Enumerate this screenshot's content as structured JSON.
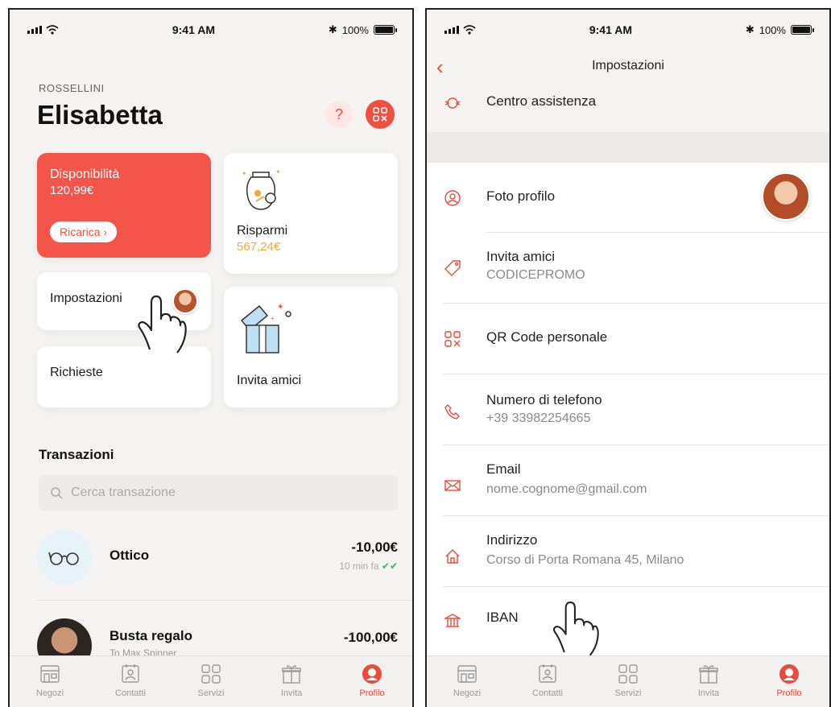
{
  "status_bar": {
    "time": "9:41 AM",
    "battery": "100%"
  },
  "left": {
    "surname": "ROSSELLINI",
    "firstname": "Elisabetta",
    "help_label": "?",
    "cards": {
      "disponibilita": {
        "title": "Disponibilità",
        "amount": "120,99€",
        "button": "Ricarica ›"
      },
      "risparmi": {
        "title": "Risparmi",
        "amount": "567,24€"
      },
      "impostazioni": {
        "title": "Impostazioni"
      },
      "invita": {
        "title": "Invita amici"
      },
      "richieste": {
        "title": "Richieste"
      }
    },
    "transactions_title": "Transazioni",
    "search_placeholder": "Cerca transazione",
    "transactions": [
      {
        "name": "Ottico",
        "sub": "",
        "amount": "-10,00€",
        "time": "10 min fa",
        "status": "✔✔"
      },
      {
        "name": "Busta regalo",
        "sub": "To Max Spinner",
        "amount": "-100,00€",
        "time": ""
      }
    ]
  },
  "right": {
    "title": "Impostazioni",
    "back_label": "‹",
    "items": {
      "centro": {
        "label": "Centro assistenza"
      },
      "foto": {
        "label": "Foto profilo"
      },
      "invita": {
        "label": "Invita amici",
        "sub": "CODICEPROMO"
      },
      "qr": {
        "label": "QR Code personale"
      },
      "telefono": {
        "label": "Numero di telefono",
        "sub": "+39 33982254665"
      },
      "email": {
        "label": "Email",
        "sub": "nome.cognome@gmail.com"
      },
      "indirizzo": {
        "label": "Indirizzo",
        "sub": "Corso di Porta Romana 45, Milano"
      },
      "iban": {
        "label": "IBAN"
      }
    }
  },
  "tabbar": [
    {
      "label": "Negozi",
      "icon": "shop-icon"
    },
    {
      "label": "Contatti",
      "icon": "contacts-icon"
    },
    {
      "label": "Servizi",
      "icon": "grid-icon"
    },
    {
      "label": "Invita",
      "icon": "gift-icon"
    },
    {
      "label": "Profilo",
      "icon": "profile-icon",
      "active": true
    }
  ],
  "colors": {
    "accent": "#f0503f",
    "savings": "#f2a73b",
    "check": "#3cb54a",
    "background": "#f4f3f2"
  }
}
